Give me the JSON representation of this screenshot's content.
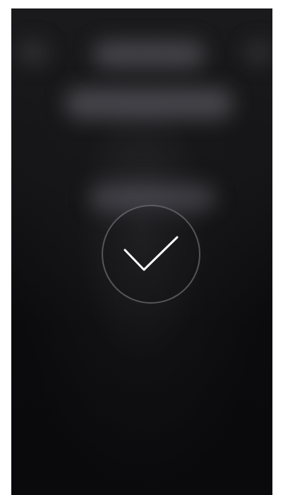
{
  "screen": {
    "state": "confirmation",
    "icon": "checkmark-icon",
    "colors": {
      "background": "#0a0a0c",
      "circle_border": "#78787e",
      "checkmark": "#ffffff"
    }
  }
}
